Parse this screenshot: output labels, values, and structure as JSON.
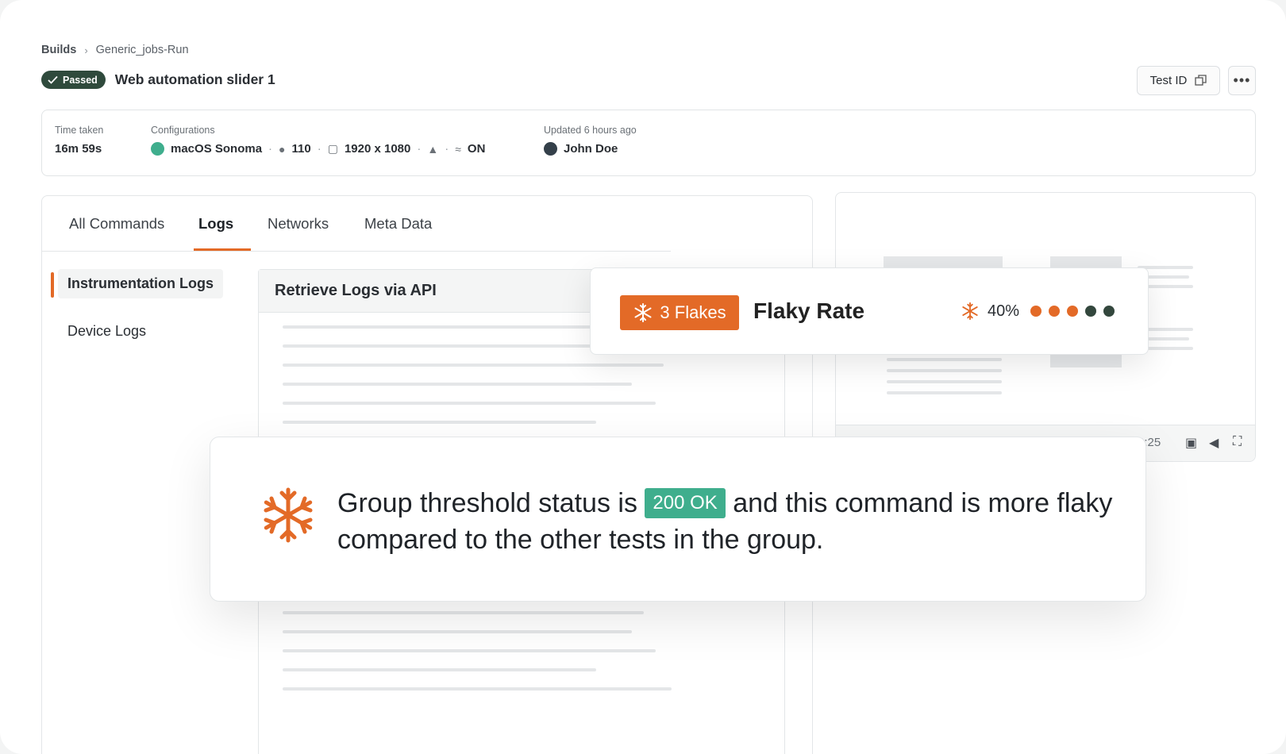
{
  "breadcrumb": {
    "root": "Builds",
    "current": "Generic_jobs-Run"
  },
  "header": {
    "status": "Passed",
    "title": "Web automation slider 1",
    "test_id_label": "Test ID",
    "more_label": "•••"
  },
  "info": {
    "time_taken_label": "Time taken",
    "time_taken_value": "16m 59s",
    "configurations_label": "Configurations",
    "os": "macOS Sonoma",
    "browser_version": "110",
    "resolution": "1920 x 1080",
    "network": "ON",
    "updated_label": "Updated 6 hours ago",
    "user": "John Doe"
  },
  "tabs": [
    "All Commands",
    "Logs",
    "Networks",
    "Meta Data"
  ],
  "sidebar": {
    "items": [
      "Instrumentation Logs",
      "Device Logs"
    ]
  },
  "logs": {
    "title": "Retrieve Logs via API"
  },
  "player": {
    "time": "2:25"
  },
  "flaky": {
    "badge": "3 Flakes",
    "title": "Flaky Rate",
    "rate": "40%",
    "dots": [
      "#e36a27",
      "#e36a27",
      "#e36a27",
      "#33473d",
      "#33473d"
    ]
  },
  "threshold": {
    "text_before": "Group threshold status is",
    "chip": "200 OK",
    "text_after": "and this command is more flaky compared to the other tests in the group."
  },
  "colors": {
    "accent": "#e36a27",
    "success": "#3fae8d",
    "passed_badge": "#2f4a3c"
  }
}
